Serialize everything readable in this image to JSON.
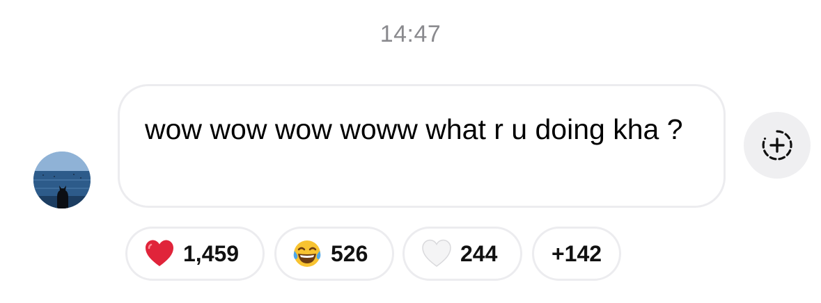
{
  "timestamp": "14:47",
  "message": {
    "text": "wow wow wow woww what r u doing kha ?"
  },
  "add_reaction_icon": "add-reaction-dashed-circle-plus-icon",
  "reactions": [
    {
      "emoji": "red-heart",
      "count": "1,459"
    },
    {
      "emoji": "face-with-tears-of-joy",
      "count": "526"
    },
    {
      "emoji": "white-heart",
      "count": "244"
    }
  ],
  "more_reactions": "+142",
  "colors": {
    "timestamp": "#8a8a8e",
    "bubble_border": "#ececef",
    "react_button_bg": "#efeff1",
    "heart_red": "#e0243a"
  }
}
